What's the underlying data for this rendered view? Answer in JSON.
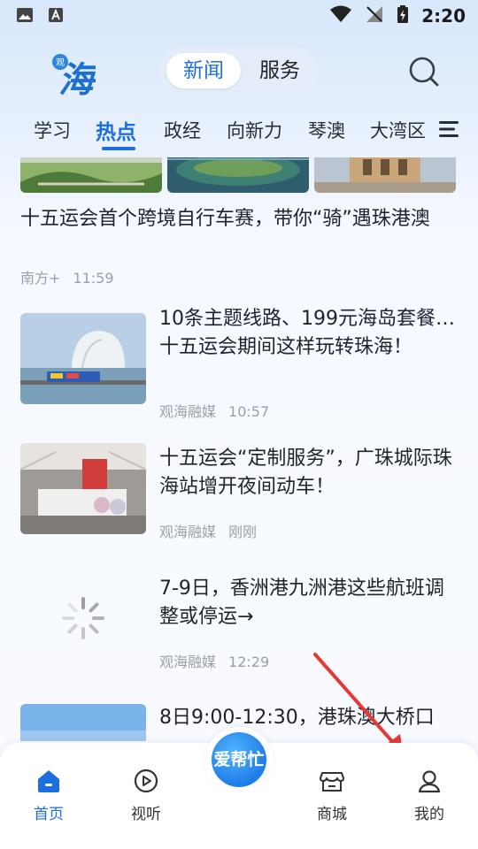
{
  "status_bar": {
    "time": "2:20"
  },
  "header": {
    "logo_text": "海",
    "logo_small": "观",
    "segments": {
      "news": "新闻",
      "service": "服务"
    }
  },
  "tabs": [
    "学习",
    "热点",
    "政经",
    "向新力",
    "琴澳",
    "大湾区"
  ],
  "active_tab": "热点",
  "feed": [
    {
      "title": "十五运会首个跨境自行车赛，带你“骑”遇珠港澳",
      "source": "南方+",
      "time": "11:59"
    },
    {
      "title": "10条主题线路、199元海岛套餐…十五运会期间这样玩转珠海！",
      "source": "观海融媒",
      "time": "10:57"
    },
    {
      "title": "十五运会“定制服务”，广珠城际珠海站增开夜间动车！",
      "source": "观海融媒",
      "time": "刚刚"
    },
    {
      "title": "7-9日，香洲港九洲港这些航班调整或停运→",
      "source": "观海融媒",
      "time": "12:29"
    },
    {
      "title": "8日9:00-12:30，港珠澳大桥口",
      "source": "",
      "time": ""
    }
  ],
  "bottom_nav": {
    "home": "首页",
    "video": "视听",
    "center": "爱帮忙",
    "mall": "商城",
    "mine": "我的"
  },
  "colors": {
    "accent": "#1d6fe0",
    "muted": "#9aa0a8"
  }
}
